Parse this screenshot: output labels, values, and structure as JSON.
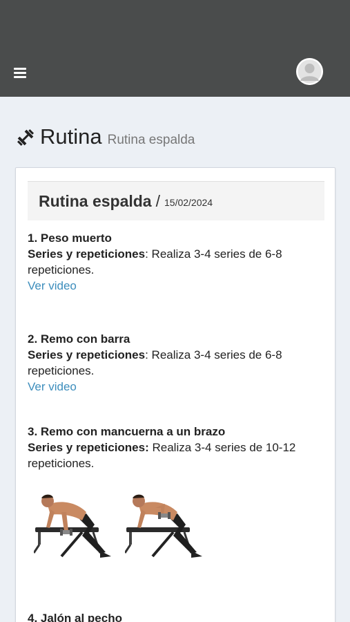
{
  "header": {
    "menu_icon": "bars-icon",
    "avatar_icon": "user-avatar-icon",
    "colors": {
      "topbar": "#4a4c4c",
      "link": "#3c8dbc",
      "background": "#ecf0f5"
    }
  },
  "page": {
    "icon": "dumbbell-icon",
    "title": "Rutina",
    "subtitle": "Rutina espalda"
  },
  "card": {
    "title": "Rutina espalda",
    "separator": "/",
    "date": "15/02/2024"
  },
  "exercises": [
    {
      "title": "1. Peso muerto",
      "label": "Series y repeticiones",
      "text": ": Realiza 3-4 series de 6-8 repeticiones.",
      "link": "Ver video"
    },
    {
      "title": "2. Remo con barra",
      "label": "Series y repeticiones",
      "text": ": Realiza 3-4 series de 6-8 repeticiones.",
      "link": "Ver video"
    },
    {
      "title": "3. Remo con mancuerna a un brazo",
      "label": "Series y repeticiones:",
      "text": " Realiza 3-4 series de 10-12 repeticiones."
    },
    {
      "title": "4. Jalón al pecho"
    }
  ]
}
